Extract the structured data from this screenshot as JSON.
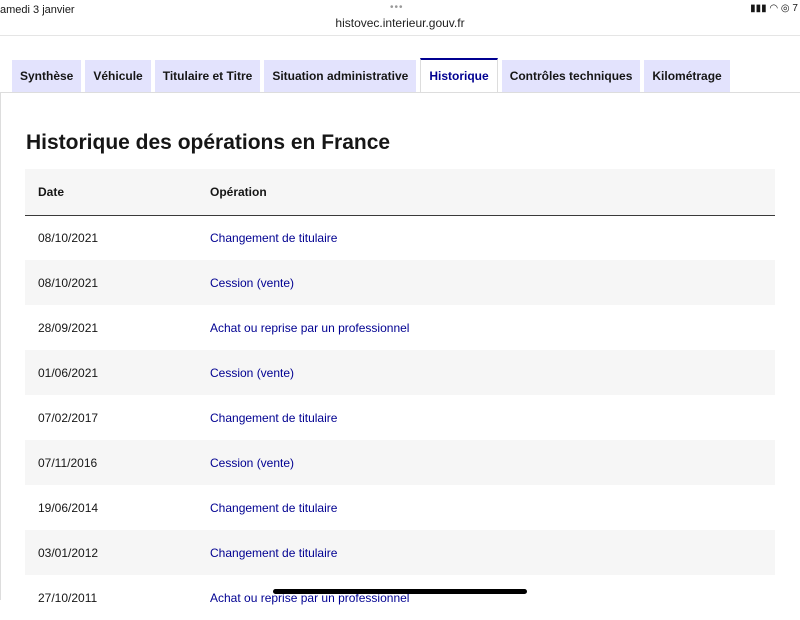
{
  "status": {
    "date": "amedi 3 janvier",
    "icons": "▮▮▮ ◠ ◎ 7"
  },
  "browser": {
    "dots": "•••",
    "url": "histovec.interieur.gouv.fr"
  },
  "tabs": [
    "Synthèse",
    "Véhicule",
    "Titulaire et Titre",
    "Situation administrative",
    "Historique",
    "Contrôles techniques",
    "Kilométrage"
  ],
  "active_tab": 4,
  "title": "Historique des opérations en France",
  "table": {
    "headers": [
      "Date",
      "Opération"
    ],
    "rows": [
      [
        "08/10/2021",
        "Changement de titulaire"
      ],
      [
        "08/10/2021",
        "Cession (vente)"
      ],
      [
        "28/09/2021",
        "Achat ou reprise par un professionnel"
      ],
      [
        "01/06/2021",
        "Cession (vente)"
      ],
      [
        "07/02/2017",
        "Changement de titulaire"
      ],
      [
        "07/11/2016",
        "Cession (vente)"
      ],
      [
        "19/06/2014",
        "Changement de titulaire"
      ],
      [
        "03/01/2012",
        "Changement de titulaire"
      ],
      [
        "27/10/2011",
        "Achat ou reprise par un professionnel"
      ]
    ]
  }
}
